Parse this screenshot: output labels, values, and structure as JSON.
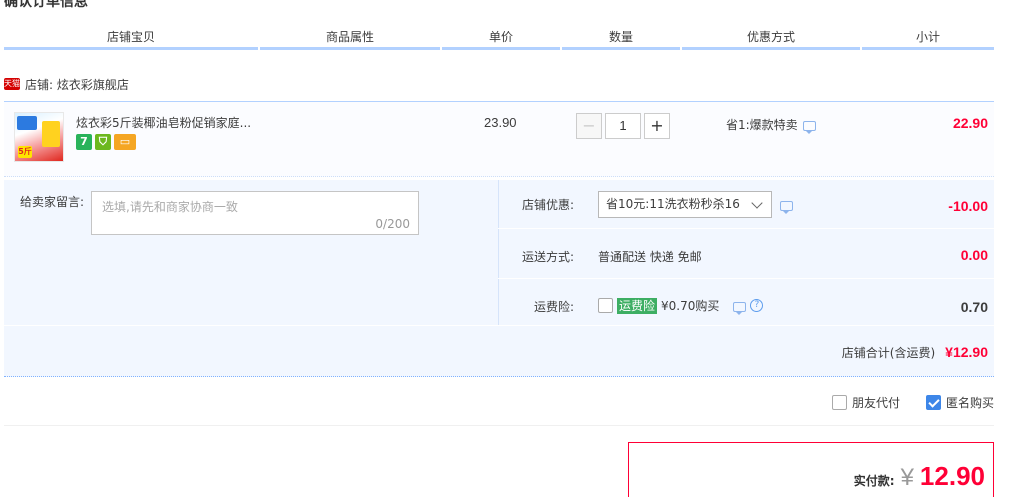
{
  "section_title": "确认订单信息",
  "columns": [
    "店铺宝贝",
    "商品属性",
    "单价",
    "数量",
    "优惠方式",
    "小计"
  ],
  "shop": {
    "badge": "天猫",
    "label": "店铺: 炫衣彩旗舰店"
  },
  "item": {
    "thumb_text": "5斤",
    "title": "炫衣彩5斤装椰油皂粉促销家庭...",
    "icons": [
      "7",
      "⛉",
      "▭"
    ],
    "unit_price": "23.90",
    "quantity": "1",
    "discount": "省1:爆款特卖",
    "subtotal": "22.90"
  },
  "message": {
    "label": "给卖家留言:",
    "placeholder": "选填,请先和商家协商一致",
    "count": "0/200"
  },
  "shop_discount": {
    "label": "店铺优惠:",
    "selected": "省10元:11洗衣粉秒杀16",
    "value": "-10.00"
  },
  "shipping": {
    "label": "运送方式:",
    "method": "普通配送 快递 免邮",
    "value": "0.00"
  },
  "insurance": {
    "label": "运费险:",
    "tag": "运费险",
    "text": "¥0.70购买",
    "help": "?",
    "value": "0.70"
  },
  "shop_total": {
    "label": "店铺合计(含运费)",
    "value": "¥12.90"
  },
  "options": {
    "friend_pay": "朋友代付",
    "anonymous": "匿名购买"
  },
  "payment": {
    "label": "实付款:",
    "currency": "¥",
    "amount": "12.90"
  }
}
